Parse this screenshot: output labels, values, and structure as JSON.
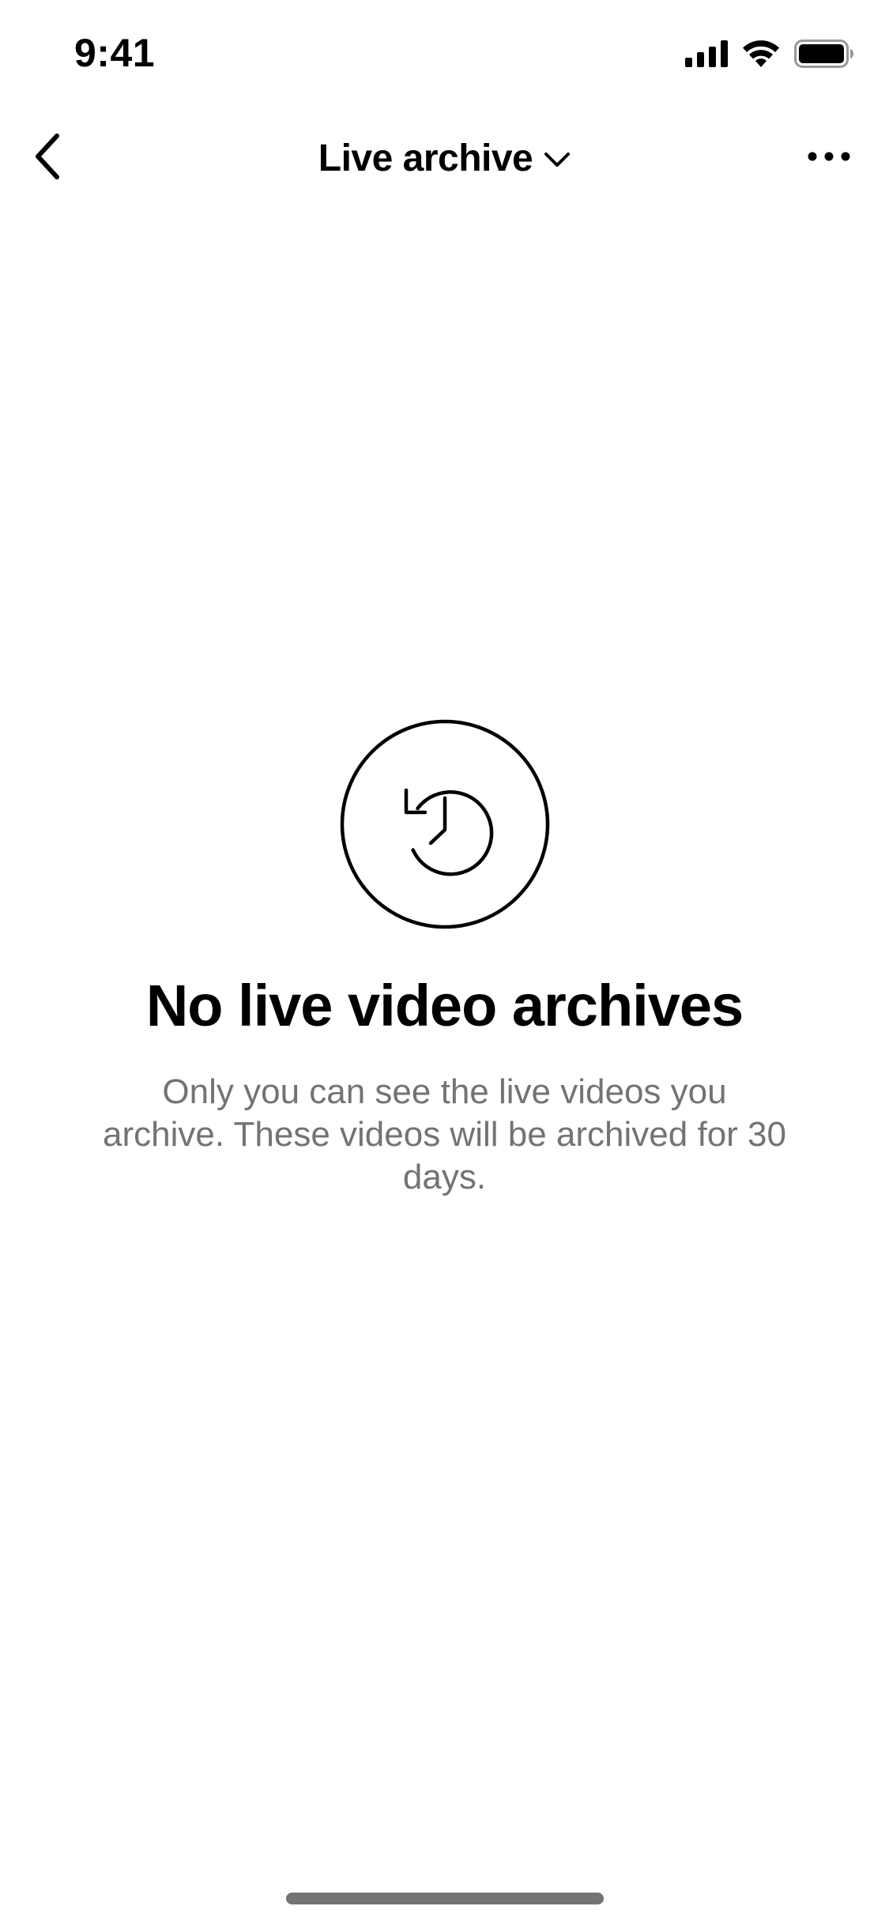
{
  "status_bar": {
    "time": "9:41"
  },
  "nav": {
    "title": "Live archive",
    "icons": {
      "back": "chevron-left-icon",
      "title_dropdown": "chevron-down-icon",
      "more": "more-horizontal-icon"
    }
  },
  "empty_state": {
    "icon": "history-clock-icon",
    "title": "No live video archives",
    "description": "Only you can see the live videos you archive. These videos will be archived for 30 days."
  },
  "colors": {
    "text_primary": "#000000",
    "text_secondary": "#737373",
    "background": "#ffffff"
  }
}
